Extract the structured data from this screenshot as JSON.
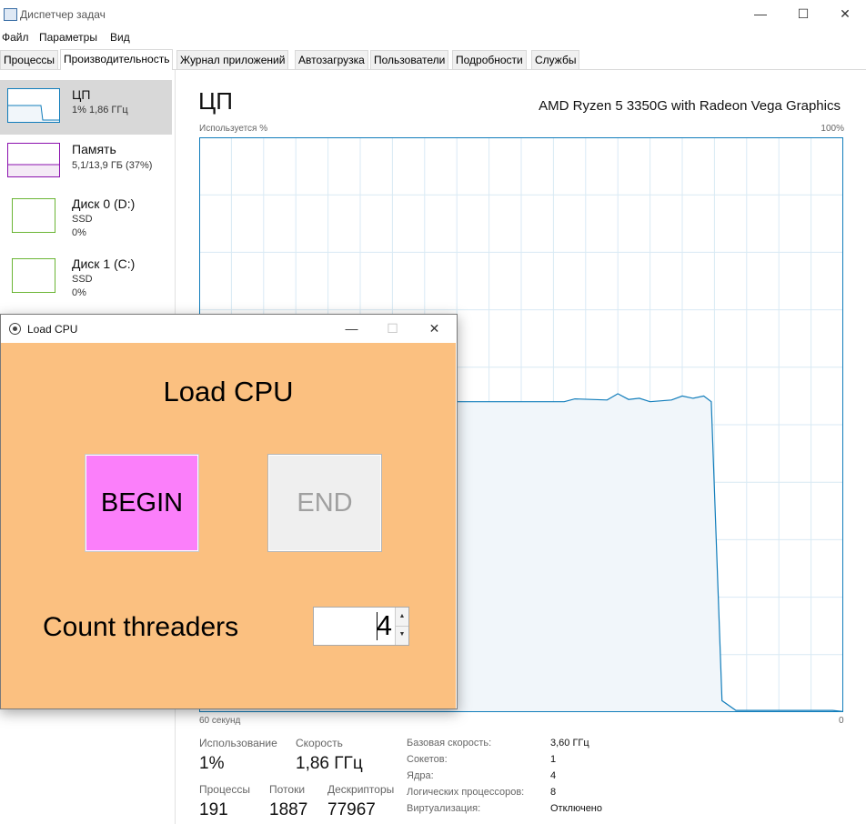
{
  "window": {
    "title": "Диспетчер задач"
  },
  "menu": [
    "Файл",
    "Параметры",
    "Вид"
  ],
  "tabs": [
    "Процессы",
    "Производительность",
    "Журнал приложений",
    "Автозагрузка",
    "Пользователи",
    "Подробности",
    "Службы"
  ],
  "active_tab": "Производительность",
  "sidebar": {
    "items": [
      {
        "title": "ЦП",
        "sub1": "1% 1,86 ГГц",
        "sub2": "",
        "color": "#117dbb"
      },
      {
        "title": "Память",
        "sub1": "5,1/13,9 ГБ (37%)",
        "sub2": "",
        "color": "#8b12ae"
      },
      {
        "title": "Диск 0 (D:)",
        "sub1": "SSD",
        "sub2": "0%",
        "color": "#4da60c"
      },
      {
        "title": "Диск 1 (C:)",
        "sub1": "SSD",
        "sub2": "0%",
        "color": "#4da60c"
      }
    ]
  },
  "main": {
    "title": "ЦП",
    "model": "AMD Ryzen 5 3350G with Radeon Vega Graphics",
    "graph_top_left": "Используется %",
    "graph_top_right": "100%",
    "graph_bottom_left": "60 секунд",
    "graph_bottom_right": "0",
    "stats": {
      "util_label": "Использование",
      "util_value": "1%",
      "speed_label": "Скорость",
      "speed_value": "1,86 ГГц",
      "proc_label": "Процессы",
      "proc_value": "191",
      "threads_label": "Потоки",
      "threads_value": "1887",
      "handles_label": "Дескрипторы",
      "handles_value": "77967"
    },
    "details": [
      {
        "label": "Базовая скорость:",
        "value": "3,60 ГГц"
      },
      {
        "label": "Сокетов:",
        "value": "1"
      },
      {
        "label": "Ядра:",
        "value": "4"
      },
      {
        "label": "Логических процессоров:",
        "value": "8"
      },
      {
        "label": "Виртуализация:",
        "value": "Отключено"
      }
    ]
  },
  "chart_data": {
    "type": "area",
    "x_label_left": "60 секунд",
    "x_label_right": "0",
    "y_label": "Используется %",
    "y_max_label": "100%",
    "ylim": [
      0,
      100
    ],
    "xlim": [
      60,
      0
    ],
    "x": [
      60,
      50,
      45,
      40,
      35,
      30,
      26,
      25,
      22,
      21,
      20,
      19,
      18,
      16,
      15,
      14,
      13,
      12.3,
      11.3,
      10,
      8,
      6,
      4,
      2,
      1,
      0
    ],
    "values": [
      54,
      54,
      54,
      54,
      54,
      54,
      54,
      54.5,
      54.3,
      55.4,
      54.4,
      54.6,
      54,
      54.3,
      55,
      54.6,
      55,
      54,
      2,
      0.3,
      0.3,
      0.3,
      0.3,
      0.3,
      0.3,
      0.1
    ],
    "grid": true,
    "color": "#117dbb",
    "fill": "#f1f6fa"
  },
  "load_cpu": {
    "title": "Load CPU",
    "heading": "Load CPU",
    "begin_label": "BEGIN",
    "end_label": "END",
    "count_label": "Count threaders",
    "count_value": "4",
    "colors": {
      "background": "#fbc080",
      "begin": "#fb7ffa",
      "end": "#efefef"
    }
  },
  "icons": [
    "task-manager-icon",
    "minimize-icon",
    "maximize-icon",
    "close-icon",
    "load-cpu-app-icon",
    "spin-up-icon",
    "spin-down-icon"
  ]
}
